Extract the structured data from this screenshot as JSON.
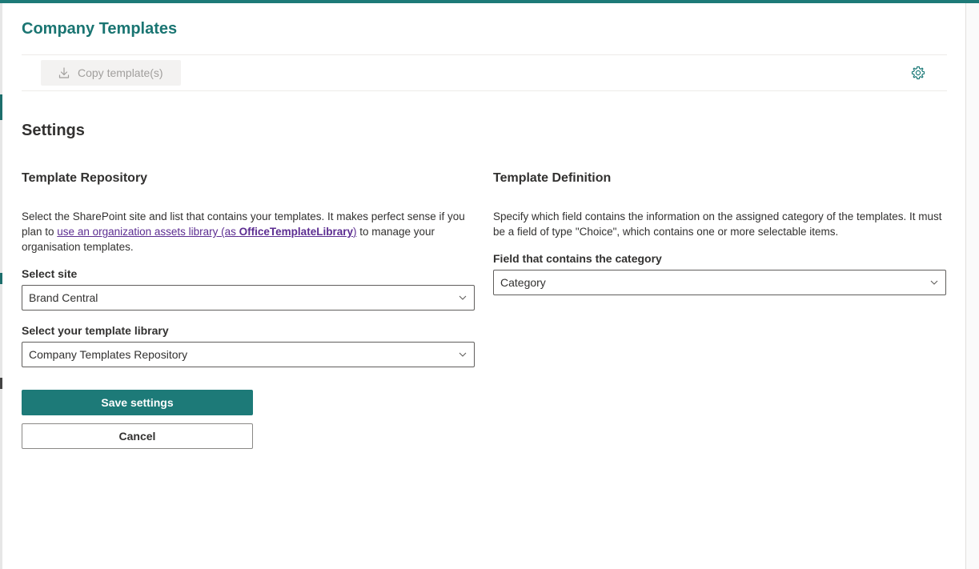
{
  "panel": {
    "title": "Company Templates"
  },
  "toolbar": {
    "copy_label": "Copy template(s)",
    "copy_icon": "download-icon",
    "settings_icon": "gear-icon"
  },
  "settings": {
    "heading": "Settings",
    "repository": {
      "heading": "Template Repository",
      "description_before": "Select the SharePoint site and list that contains your templates. It makes perfect sense if you plan to ",
      "link_text": "use an organization assets library (as ",
      "link_bold": "OfficeTemplateLibrary",
      "link_after": ")",
      "description_after": " to manage your organisation templates.",
      "site_label": "Select site",
      "site_value": "Brand Central",
      "library_label": "Select your template library",
      "library_value": "Company Templates Repository"
    },
    "definition": {
      "heading": "Template Definition",
      "description": "Specify which field contains the information on the assigned category of the templates. It must be a field of type \"Choice\", which contains one or more selectable items.",
      "field_label": "Field that contains the category",
      "field_value": "Category"
    },
    "save_label": "Save settings",
    "cancel_label": "Cancel"
  },
  "colors": {
    "accent": "#1d7a78",
    "link": "#5c2d91",
    "disabled_bg": "#f3f2f1",
    "disabled_text": "#a19f9d"
  }
}
